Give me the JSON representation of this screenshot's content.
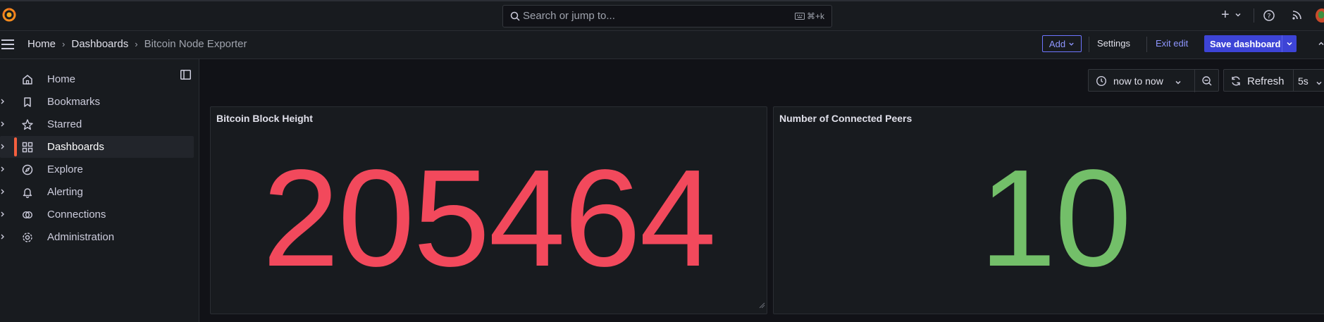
{
  "topbar": {
    "search_placeholder": "Search or jump to...",
    "search_shortcut": "⌘+k",
    "icons": [
      "grafana-logo-icon",
      "search-icon",
      "keyboard-icon",
      "plus-icon",
      "help-icon",
      "rss-icon",
      "avatar"
    ]
  },
  "breadcrumb": {
    "items": [
      "Home",
      "Dashboards",
      "Bitcoin Node Exporter"
    ]
  },
  "toolbar": {
    "add_label": "Add",
    "settings_label": "Settings",
    "exit_edit_label": "Exit edit",
    "save_label": "Save dashboard"
  },
  "sidebar": {
    "items": [
      {
        "label": "Home",
        "icon": "home-icon",
        "active": false,
        "expandable": false
      },
      {
        "label": "Bookmarks",
        "icon": "bookmark-icon",
        "active": false,
        "expandable": true
      },
      {
        "label": "Starred",
        "icon": "star-icon",
        "active": false,
        "expandable": true
      },
      {
        "label": "Dashboards",
        "icon": "apps-icon",
        "active": true,
        "expandable": true
      },
      {
        "label": "Explore",
        "icon": "compass-icon",
        "active": false,
        "expandable": true
      },
      {
        "label": "Alerting",
        "icon": "bell-icon",
        "active": false,
        "expandable": true
      },
      {
        "label": "Connections",
        "icon": "link-icon",
        "active": false,
        "expandable": true
      },
      {
        "label": "Administration",
        "icon": "cog-icon",
        "active": false,
        "expandable": true
      }
    ]
  },
  "controls": {
    "time_range": "now to now",
    "refresh_label": "Refresh",
    "refresh_interval": "5s"
  },
  "panels": [
    {
      "title": "Bitcoin Block Height",
      "value": "205464",
      "color": "#f2495c"
    },
    {
      "title": "Number of Connected Peers",
      "value": "10",
      "color": "#73bf69"
    }
  ],
  "colors": {
    "accent": "#3d44d6",
    "active_indicator": "#f55f3e",
    "background": "#111217",
    "panel": "#181b1f"
  }
}
